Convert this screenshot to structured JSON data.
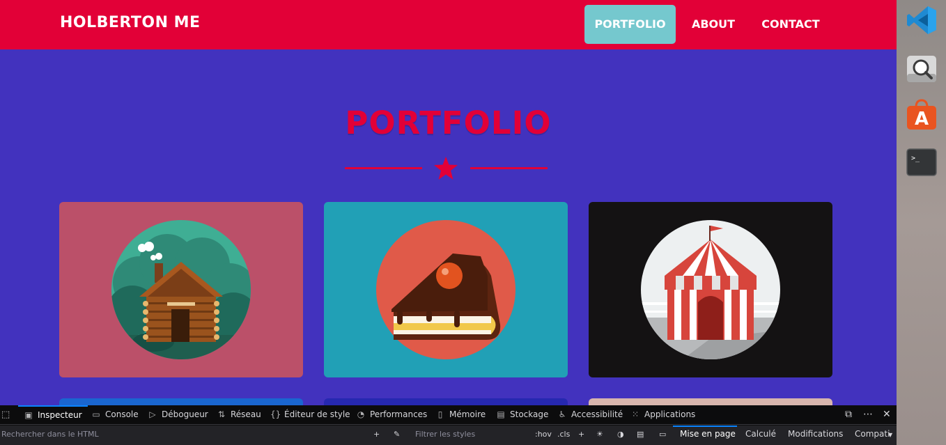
{
  "navbar": {
    "brand": "HOLBERTON ME",
    "items": [
      {
        "label": "PORTFOLIO",
        "active": true
      },
      {
        "label": "ABOUT",
        "active": false
      },
      {
        "label": "CONTACT",
        "active": false
      }
    ]
  },
  "portfolio": {
    "title": "PORTFOLIO",
    "cards": [
      {
        "icon": "log-cabin-icon",
        "bg": "#bb5069"
      },
      {
        "icon": "cake-slice-icon",
        "bg": "#21a0b6"
      },
      {
        "icon": "circus-tent-icon",
        "bg": "#141213"
      }
    ],
    "next_row_colors": [
      "#1a66d0",
      "#2628b0",
      "#d8b5ad"
    ]
  },
  "colors": {
    "accent": "#e20037",
    "page_bg": "#4232be",
    "nav_active": "#75c8ce"
  },
  "devtools": {
    "tabs": [
      {
        "label": "Inspecteur",
        "icon": "inspector-icon",
        "active": true
      },
      {
        "label": "Console",
        "icon": "console-icon"
      },
      {
        "label": "Débogueur",
        "icon": "debugger-icon"
      },
      {
        "label": "Réseau",
        "icon": "network-icon"
      },
      {
        "label": "Éditeur de style",
        "icon": "style-editor-icon"
      },
      {
        "label": "Performances",
        "icon": "performance-icon"
      },
      {
        "label": "Mémoire",
        "icon": "memory-icon"
      },
      {
        "label": "Stockage",
        "icon": "storage-icon"
      },
      {
        "label": "Accessibilité",
        "icon": "accessibility-icon"
      },
      {
        "label": "Applications",
        "icon": "applications-icon"
      }
    ],
    "search_placeholder": "Rechercher dans le HTML",
    "filter_placeholder": "Filtrer les styles",
    "hov": ":hov",
    "cls": ".cls",
    "side_tabs": [
      {
        "label": "Mise en page",
        "active": true
      },
      {
        "label": "Calculé"
      },
      {
        "label": "Modifications"
      },
      {
        "label": "Compati"
      }
    ]
  },
  "dock": {
    "apps": [
      "vscode-icon",
      "search-app-icon",
      "software-store-icon",
      "terminal-icon"
    ],
    "terminal_prompt": ">_"
  }
}
